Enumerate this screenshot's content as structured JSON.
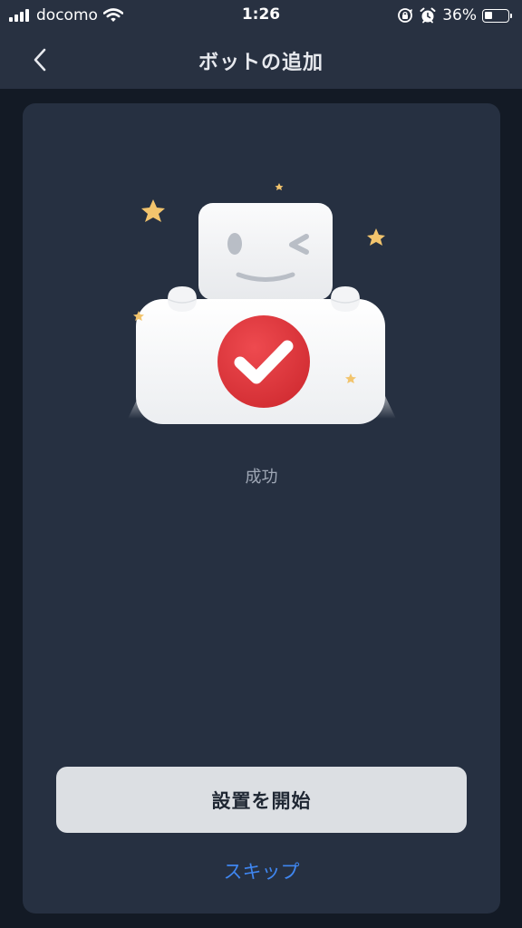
{
  "status_bar": {
    "carrier": "docomo",
    "time": "1:26",
    "battery_percent": "36%",
    "battery_level": 0.36,
    "icons": [
      "signal-bars-icon",
      "wifi-icon",
      "orientation-lock-icon",
      "alarm-icon",
      "battery-icon"
    ]
  },
  "nav": {
    "title": "ボットの追加",
    "back_icon": "chevron-left-icon"
  },
  "main": {
    "illustration_icons": [
      "robot-icon",
      "checkmark-icon",
      "star-icon"
    ],
    "success_text": "成功",
    "primary_button_label": "設置を開始",
    "skip_label": "スキップ"
  },
  "colors": {
    "header_bg": "#283141",
    "page_bg": "#131a25",
    "card_bg": "#263041",
    "accent_blue": "#3f86f0",
    "check_red": "#e23a3f",
    "button_bg": "#dcdfe3"
  }
}
